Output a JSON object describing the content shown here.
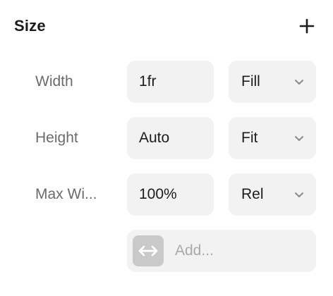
{
  "section": {
    "title": "Size",
    "add_icon": "plus-icon"
  },
  "rows": [
    {
      "label": "Width",
      "value": "1fr",
      "mode": "Fill"
    },
    {
      "label": "Height",
      "value": "Auto",
      "mode": "Fit"
    },
    {
      "label": "Max Wi...",
      "value": "100%",
      "mode": "Rel"
    }
  ],
  "add_constraint": {
    "icon": "horizontal-resize-icon",
    "placeholder": "Add..."
  },
  "colors": {
    "field_background": "#f2f2f2",
    "label_text": "#6b6b6b",
    "placeholder_text": "#a9a9a9",
    "icon_tile": "#c9c9c9"
  }
}
